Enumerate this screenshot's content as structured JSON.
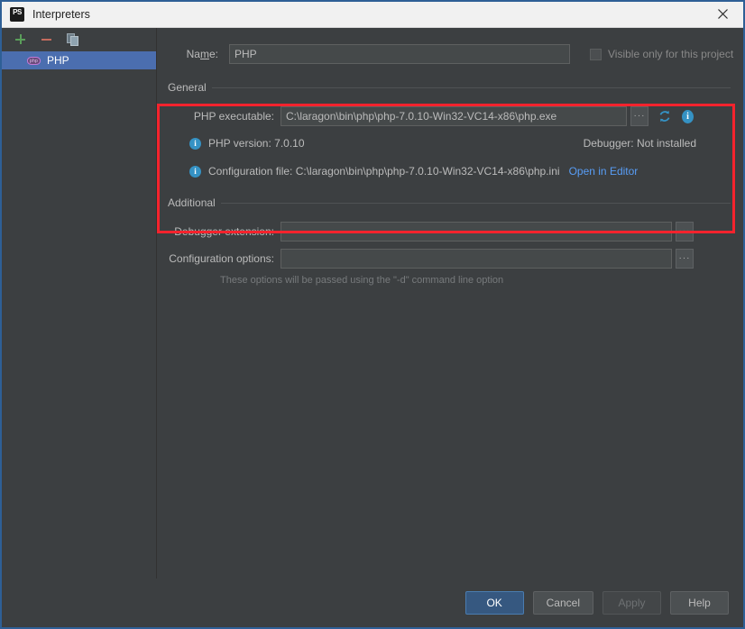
{
  "window": {
    "title": "Interpreters",
    "app_icon": "PS",
    "close_icon": "close-icon"
  },
  "sidebar": {
    "toolbar": [
      {
        "name": "add-interpreter-button",
        "icon": "plus-icon",
        "label": "+"
      },
      {
        "name": "remove-interpreter-button",
        "icon": "minus-icon",
        "label": "−"
      },
      {
        "name": "copy-interpreter-button",
        "icon": "copy-icon",
        "label": ""
      }
    ],
    "items": [
      {
        "label": "PHP",
        "icon": "php-icon",
        "badge": "php",
        "selected": true
      }
    ]
  },
  "form": {
    "name_label_pre": "Na",
    "name_label_mnemonic": "m",
    "name_label_post": "e:",
    "name_value": "PHP",
    "name_placeholder": "",
    "visible_only_checkbox": {
      "label": "Visible only for this project",
      "checked": false,
      "disabled": true
    }
  },
  "general": {
    "title": "General",
    "php_executable_label": "PHP executable:",
    "php_executable_value": "C:\\laragon\\bin\\php\\php-7.0.10-Win32-VC14-x86\\php.exe",
    "php_executable_placeholder": "",
    "browse_label": "···",
    "refresh_icon": "refresh-icon",
    "info_icon": "info-icon",
    "php_version_text": "PHP version: 7.0.10",
    "debugger_text": "Debugger: Not installed",
    "configuration_file_text": "Configuration file: C:\\laragon\\bin\\php\\php-7.0.10-Win32-VC14-x86\\php.ini",
    "open_in_editor_link": "Open in Editor",
    "info_glyph": "i"
  },
  "additional": {
    "title": "Additional",
    "debugger_extension_label": "Debugger extension:",
    "debugger_extension_value": "",
    "debugger_extension_placeholder": "",
    "configuration_options_label": "Configuration options:",
    "configuration_options_value": "",
    "configuration_options_placeholder": "",
    "hint": "These options will be passed using the \"-d\" command line option",
    "browse_label": "···"
  },
  "footer": {
    "ok_label": "OK",
    "cancel_label": "Cancel",
    "apply_label": "Apply",
    "help_label": "Help"
  },
  "colors": {
    "window_border": "#2e5f96",
    "background": "#3c3f41",
    "selection": "#4b6eaf",
    "primary_button": "#365880",
    "link": "#589df6",
    "info_icon": "#3592c4",
    "annotation": "#f5232d",
    "text": "#bbbbbb",
    "hint_text": "#777a7c"
  }
}
